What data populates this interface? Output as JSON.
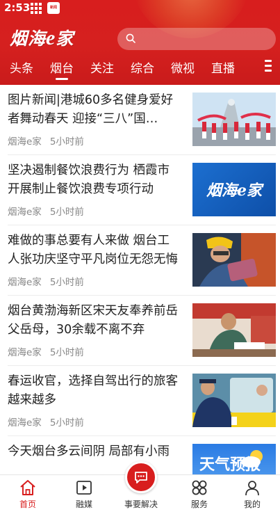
{
  "status_bar": {
    "time": "2:53",
    "app_badge": "新闻"
  },
  "header": {
    "logo_main": "烟海",
    "logo_e": "e",
    "logo_tail": "家",
    "search_placeholder": ""
  },
  "tabs": [
    {
      "label": "头条"
    },
    {
      "label": "烟台"
    },
    {
      "label": "关注"
    },
    {
      "label": "综合"
    },
    {
      "label": "微视"
    },
    {
      "label": "直播"
    }
  ],
  "active_tab": "烟台",
  "feed": [
    {
      "title": "图片新闻|港城60多名健身爱好者舞动春天 迎接“三八”国…",
      "source": "烟海e家",
      "time": "5小时前",
      "thumb": "dance-photo"
    },
    {
      "title": "坚决遏制餐饮浪费行为 栖霞市开展制止餐饮浪费专项行动",
      "source": "烟海e家",
      "time": "5小时前",
      "thumb": "logo-banner",
      "thumb_text": "烟海e家"
    },
    {
      "title": "难做的事总要有人来做 烟台工人张功庆坚守平凡岗位无怨无悔",
      "source": "烟海e家",
      "time": "5小时前",
      "thumb": "worker-photo"
    },
    {
      "title": "烟台黄渤海新区宋天友奉养前岳父岳母，30余载不离不弃",
      "source": "烟海e家",
      "time": "5小时前",
      "thumb": "elderly-photo"
    },
    {
      "title": "春运收官，选择自驾出行的旅客越来越多",
      "source": "烟海e家",
      "time": "5小时前",
      "thumb": "toll-photo"
    },
    {
      "title": "今天烟台多云间阴  局部有小雨",
      "source": "",
      "time": "",
      "thumb": "weather-banner",
      "thumb_text": "天气预报"
    }
  ],
  "bottom_nav": [
    {
      "label": "首页",
      "icon": "home-icon"
    },
    {
      "label": "融媒",
      "icon": "play-icon"
    },
    {
      "label": "事要解决",
      "icon": "chat-icon"
    },
    {
      "label": "服务",
      "icon": "grid-icon"
    },
    {
      "label": "我的",
      "icon": "user-icon"
    }
  ],
  "colors": {
    "brand_red": "#d81e1e",
    "text": "#222222",
    "meta": "#888888"
  }
}
